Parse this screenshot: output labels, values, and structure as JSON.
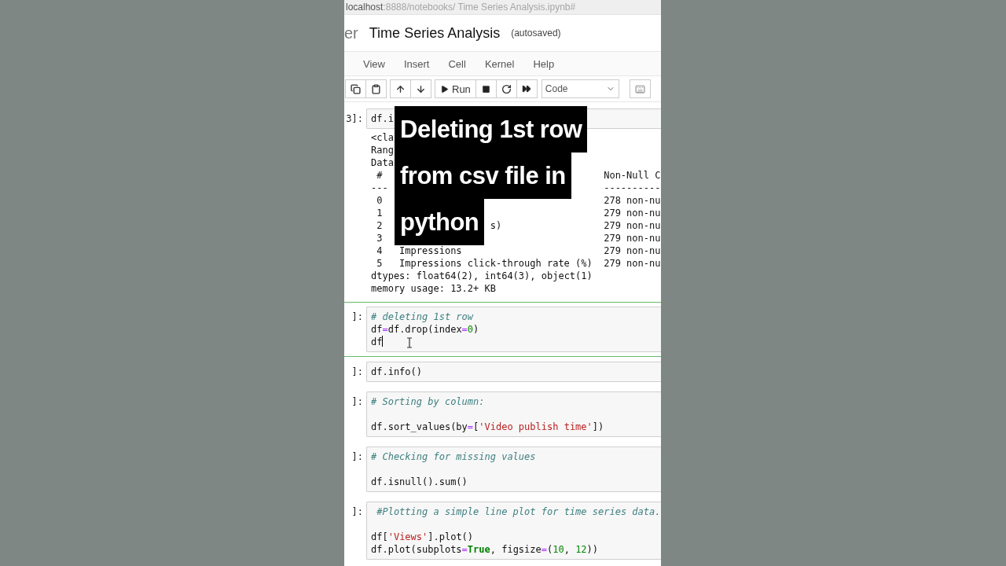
{
  "address_bar": {
    "host": "localhost",
    "path": ":8888/notebooks/ Time Series Analysis.ipynb#"
  },
  "header": {
    "logo_fragment": "er",
    "title": "Time Series Analysis",
    "save_status": "(autosaved)"
  },
  "menu": [
    "View",
    "Insert",
    "Cell",
    "Kernel",
    "Help"
  ],
  "toolbar": {
    "run_label": "Run",
    "cell_type": "Code"
  },
  "cells": [
    {
      "prompt": "3]:",
      "selected": false,
      "lines": [
        {
          "kind": "code",
          "tokens": [
            {
              "text": "df.i",
              "kind": "plain"
            }
          ]
        }
      ],
      "output": [
        {
          "kind": "text",
          "text": "<cla"
        },
        {
          "kind": "text",
          "text": "Rang"
        },
        {
          "kind": "text",
          "text": "Data"
        },
        {
          "kind": "column",
          "index": " #",
          "non_null": "Non-Null C"
        },
        {
          "kind": "column",
          "index": "---",
          "non_null": "----------"
        },
        {
          "kind": "column",
          "index": " 0",
          "non_null": "278 non-nu"
        },
        {
          "kind": "column",
          "index": " 1",
          "non_null": "279 non-nu"
        },
        {
          "kind": "column",
          "index": " 2",
          "name": "s)",
          "name_clipped": true,
          "non_null": "279 non-nu"
        },
        {
          "kind": "column",
          "index": " 3",
          "non_null": "279 non-nu"
        },
        {
          "kind": "column",
          "index": " 4",
          "name": "Impressions",
          "name_clipped": false,
          "non_null": "279 non-nu"
        },
        {
          "kind": "column",
          "index": " 5",
          "name": "Impressions click-through rate (%)",
          "name_clipped": false,
          "non_null": "279 non-nu"
        },
        {
          "kind": "text",
          "text": "dtypes: float64(2), int64(3), object(1)"
        },
        {
          "kind": "text",
          "text": "memory usage: 13.2+ KB"
        }
      ]
    },
    {
      "prompt": "]:",
      "selected": true,
      "lines": [
        {
          "kind": "code",
          "tokens": [
            {
              "text": "# deleting 1st row",
              "kind": "comment"
            }
          ]
        },
        {
          "kind": "code",
          "tokens": [
            {
              "text": "df",
              "kind": "plain"
            },
            {
              "text": "=",
              "kind": "operator"
            },
            {
              "text": "df.drop(index",
              "kind": "plain"
            },
            {
              "text": "=",
              "kind": "operator"
            },
            {
              "text": "0",
              "kind": "number"
            },
            {
              "text": ")",
              "kind": "plain"
            }
          ]
        },
        {
          "kind": "code",
          "tokens": [
            {
              "text": "df",
              "kind": "plain"
            }
          ]
        }
      ]
    },
    {
      "prompt": "]:",
      "selected": false,
      "lines": [
        {
          "kind": "code",
          "tokens": [
            {
              "text": "df.info()",
              "kind": "plain"
            }
          ]
        }
      ]
    },
    {
      "prompt": "]:",
      "selected": false,
      "lines": [
        {
          "kind": "code",
          "tokens": [
            {
              "text": "# Sorting by column:",
              "kind": "comment"
            }
          ]
        },
        {
          "kind": "blank"
        },
        {
          "kind": "code",
          "tokens": [
            {
              "text": "df.sort_values(by",
              "kind": "plain"
            },
            {
              "text": "=",
              "kind": "operator"
            },
            {
              "text": "[",
              "kind": "plain"
            },
            {
              "text": "'Video publish time'",
              "kind": "string"
            },
            {
              "text": "])",
              "kind": "plain"
            }
          ]
        }
      ]
    },
    {
      "prompt": "]:",
      "selected": false,
      "lines": [
        {
          "kind": "code",
          "tokens": [
            {
              "text": "# Checking for missing values",
              "kind": "comment"
            }
          ]
        },
        {
          "kind": "blank"
        },
        {
          "kind": "code",
          "tokens": [
            {
              "text": "df.isnull().sum()",
              "kind": "plain"
            }
          ]
        }
      ]
    },
    {
      "prompt": "]:",
      "selected": false,
      "lines": [
        {
          "kind": "code",
          "tokens": [
            {
              "text": " #Plotting a simple line plot for time series data.",
              "kind": "comment"
            }
          ]
        },
        {
          "kind": "blank"
        },
        {
          "kind": "code",
          "tokens": [
            {
              "text": "df[",
              "kind": "plain"
            },
            {
              "text": "'Views'",
              "kind": "string"
            },
            {
              "text": "].plot()",
              "kind": "plain"
            }
          ]
        },
        {
          "kind": "code",
          "tokens": [
            {
              "text": "df.plot(subplots",
              "kind": "plain"
            },
            {
              "text": "=",
              "kind": "operator"
            },
            {
              "text": "True",
              "kind": "keyword"
            },
            {
              "text": ", figsize",
              "kind": "plain"
            },
            {
              "text": "=",
              "kind": "operator"
            },
            {
              "text": "(",
              "kind": "plain"
            },
            {
              "text": "10",
              "kind": "number"
            },
            {
              "text": ", ",
              "kind": "plain"
            },
            {
              "text": "12",
              "kind": "number"
            },
            {
              "text": "))",
              "kind": "plain"
            }
          ]
        }
      ]
    }
  ],
  "caption": {
    "lines": [
      "Deleting 1st row",
      "from csv file in",
      "python"
    ]
  }
}
